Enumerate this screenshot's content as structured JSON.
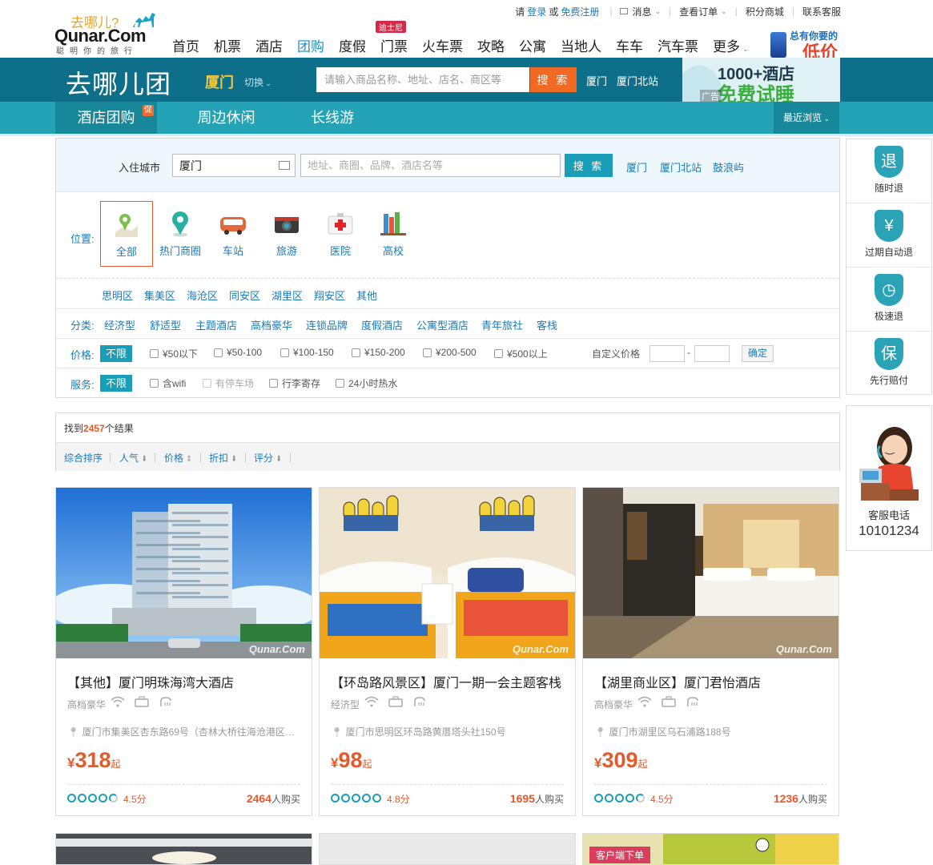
{
  "logo": {
    "cn": "去哪儿?",
    "en": "Qunar.Com",
    "slogan": "聪明你的旅行"
  },
  "utilbar": {
    "please": "请",
    "login": "登录",
    "or": "或",
    "register": "免费注册",
    "messages": "消息",
    "orders": "查看订单",
    "points": "积分商城",
    "contact": "联系客服"
  },
  "nav": {
    "items": [
      "首页",
      "机票",
      "酒店",
      "团购",
      "度假",
      "门票",
      "火车票",
      "攻略",
      "公寓",
      "当地人",
      "车车",
      "汽车票",
      "更多"
    ],
    "badge": "迪士尼",
    "active_index": 3
  },
  "phone_ad": {
    "line1": "总有你要的",
    "line2": "低价"
  },
  "brand": {
    "title": "去哪儿团",
    "city": "厦门",
    "switch": "切换"
  },
  "top_search": {
    "placeholder": "请输入商品名称、地址、店名、商区等",
    "button": "搜 索",
    "links": [
      "厦门",
      "厦门北站"
    ]
  },
  "brand_ad": {
    "line1": "1000+酒店",
    "line2": "免费试睡",
    "tag": "广告"
  },
  "subnav": {
    "tabs": [
      "酒店团购",
      "周边休闲",
      "长线游"
    ],
    "promo": "促",
    "recent": "最近浏览"
  },
  "filter": {
    "city_label": "入住城市",
    "city_value": "厦门",
    "kw_placeholder": "地址、商圈、品牌、酒店名等",
    "search_btn": "搜 索",
    "quick": [
      "厦门",
      "厦门北站",
      "鼓浪屿"
    ],
    "loc_label": "位置:",
    "locations": [
      "全部",
      "热门商圈",
      "车站",
      "旅游",
      "医院",
      "高校"
    ],
    "districts": [
      "思明区",
      "集美区",
      "海沧区",
      "同安区",
      "湖里区",
      "翔安区",
      "其他"
    ],
    "cat_label": "分类:",
    "categories": [
      "经济型",
      "舒适型",
      "主题酒店",
      "高档豪华",
      "连锁品牌",
      "度假酒店",
      "公寓型酒店",
      "青年旅社",
      "客栈"
    ],
    "price_label": "价格:",
    "nolimit": "不限",
    "prices": [
      "¥50以下",
      "¥50-100",
      "¥100-150",
      "¥150-200",
      "¥200-500",
      "¥500以上"
    ],
    "custom_price": "自定义价格",
    "dash": "-",
    "confirm": "确定",
    "svc_label": "服务:",
    "services": [
      "含wifi",
      "有停车场",
      "行李寄存",
      "24小时热水"
    ]
  },
  "result": {
    "found": "找到",
    "count": "2457",
    "unit": "个结果"
  },
  "sort": [
    "综合排序",
    "人气",
    "价格",
    "折扣",
    "评分"
  ],
  "promise": [
    {
      "icon": "退",
      "label": "随时退"
    },
    {
      "icon": "¥",
      "label": "过期自动退"
    },
    {
      "icon": "◷",
      "label": "极速退"
    },
    {
      "icon": "保",
      "label": "先行赔付"
    }
  ],
  "service": {
    "label": "客服电话",
    "phone": "10101234"
  },
  "cards": [
    {
      "title": "【其他】厦门明珠海湾大酒店",
      "type": "高档豪华",
      "addr": "厦门市集美区杏东路69号（杏林大桥往海沧港区…",
      "cur": "¥",
      "price": "318",
      "qi": "起",
      "score_value": 4.5,
      "score": "4.5分",
      "sold": "2464",
      "sold_unit": "人购买",
      "watermark": "Qunar.Com"
    },
    {
      "title": "【环岛路风景区】厦门一期一会主题客栈",
      "type": "经济型",
      "addr": "厦门市思明区环岛路黄厝塔头社150号",
      "cur": "¥",
      "price": "98",
      "qi": "起",
      "score_value": 4.8,
      "score": "4.8分",
      "sold": "1695",
      "sold_unit": "人购买",
      "watermark": "Qunar.Com"
    },
    {
      "title": "【湖里商业区】厦门君怡酒店",
      "type": "高档豪华",
      "addr": "厦门市湖里区乌石浦路188号",
      "cur": "¥",
      "price": "309",
      "qi": "起",
      "score_value": 4.5,
      "score": "4.5分",
      "sold": "1236",
      "sold_unit": "人购买",
      "watermark": "Qunar.Com"
    }
  ],
  "next_row": {
    "ribbon": "客户端下单"
  },
  "colors": {
    "teal_dark": "#0d6f89",
    "teal": "#24a3b6",
    "orange": "#e7582a",
    "link": "#1a7bb9"
  }
}
